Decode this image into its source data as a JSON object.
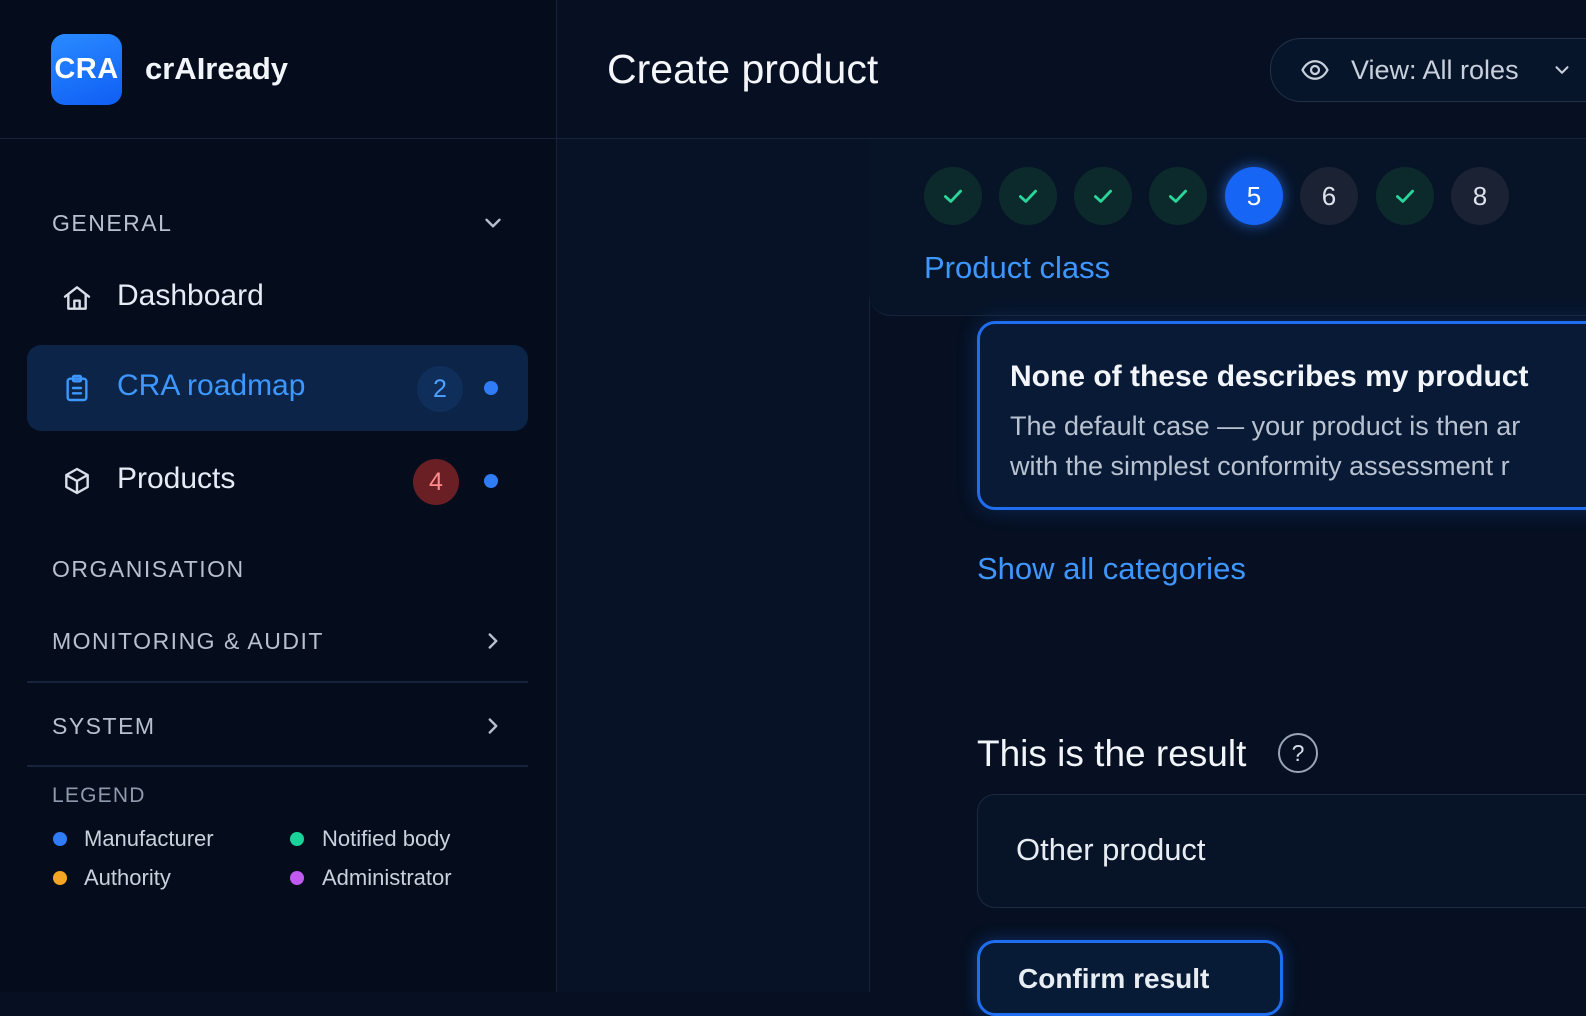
{
  "brand": {
    "logo_text": "CRA",
    "name": "crAIready"
  },
  "header": {
    "title": "Create product",
    "view_selector": "View: All roles"
  },
  "sidebar": {
    "general_label": "GENERAL",
    "items": [
      {
        "label": "Dashboard",
        "icon": "home-icon"
      },
      {
        "label": "CRA roadmap",
        "icon": "clipboard-icon",
        "badge": "2",
        "active": true
      },
      {
        "label": "Products",
        "icon": "box-icon",
        "badge": "4"
      }
    ],
    "organisation_label": "ORGANISATION",
    "monitoring_label": "MONITORING & AUDIT",
    "system_label": "SYSTEM",
    "legend": {
      "title": "LEGEND",
      "items": [
        {
          "label": "Manufacturer",
          "color": "#2f7cf6"
        },
        {
          "label": "Notified body",
          "color": "#18d39a"
        },
        {
          "label": "Authority",
          "color": "#f5a524"
        },
        {
          "label": "Administrator",
          "color": "#c05af0"
        }
      ]
    }
  },
  "stepper": {
    "steps": [
      {
        "status": "done"
      },
      {
        "status": "done"
      },
      {
        "status": "done"
      },
      {
        "status": "done"
      },
      {
        "label": "5",
        "status": "current"
      },
      {
        "label": "6",
        "status": "pending"
      },
      {
        "status": "done"
      },
      {
        "label": "8",
        "status": "pending"
      }
    ],
    "current_title": "Product class"
  },
  "choice": {
    "title": "None of these describes my product",
    "desc_line1": "The default case — your product is then ar",
    "desc_line2": "with the simplest conformity assessment r"
  },
  "show_all_link": "Show all categories",
  "result": {
    "title": "This is the result",
    "help": "?",
    "value": "Other product"
  },
  "confirm_button": "Confirm result",
  "colors": {
    "accent": "#3e97ff",
    "primary": "#1665f5",
    "success": "#2ad69a",
    "danger_badge": "#6a1f24"
  }
}
